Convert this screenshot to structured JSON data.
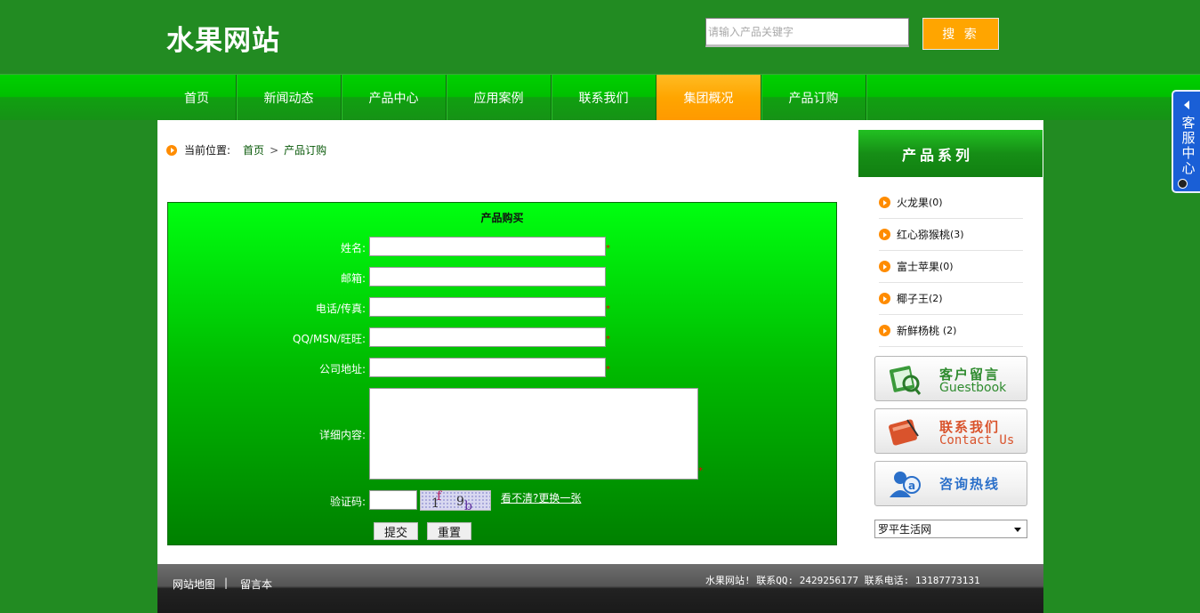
{
  "header": {
    "logo": "水果网站",
    "search_placeholder": "请输入产品关键字",
    "search_button": "搜 索"
  },
  "nav": {
    "items": [
      {
        "label": "首页"
      },
      {
        "label": "新闻动态"
      },
      {
        "label": "产品中心"
      },
      {
        "label": "应用案例"
      },
      {
        "label": "联系我们"
      },
      {
        "label": "集团概况",
        "active": true
      },
      {
        "label": "产品订购"
      }
    ]
  },
  "breadcrumb": {
    "label": "当前位置:",
    "home": "首页",
    "sep": ">",
    "current": "产品订购"
  },
  "form": {
    "title": "产品购买",
    "fields": {
      "name": "姓名:",
      "email": "邮箱:",
      "phone": "电话/传真:",
      "im": "QQ/MSN/旺旺:",
      "address": "公司地址:",
      "details": "详细内容:",
      "captcha": "验证码:"
    },
    "required_mark": "*",
    "captcha_chars": [
      "1",
      "f",
      "9",
      "b"
    ],
    "captcha_refresh": "看不清?更换一张",
    "submit": "提交",
    "reset": "重置"
  },
  "sidebar": {
    "title": "产品系列",
    "categories": [
      {
        "name": "火龙果",
        "count": "(0)"
      },
      {
        "name": "红心猕猴桃",
        "count": "(3)"
      },
      {
        "name": "富士苹果",
        "count": "(0)"
      },
      {
        "name": "椰子王",
        "count": "(2)"
      },
      {
        "name": "新鲜杨桃 ",
        "count": "(2)"
      }
    ],
    "cards": [
      {
        "title": "客户留言",
        "subtitle": "Guestbook",
        "icon": "guestbook-icon"
      },
      {
        "title": "联系我们",
        "subtitle": "Contact Us",
        "icon": "contact-book-icon"
      },
      {
        "title": "咨询热线",
        "subtitle": "",
        "icon": "hotline-user-icon"
      }
    ],
    "select_value": "罗平生活网"
  },
  "footer": {
    "sitemap": "网站地图",
    "sep": "|",
    "guestbook": "留言本",
    "info": "水果网站! 联系QQ: 2429256177 联系电话: 13187773131"
  },
  "service_tab": {
    "text": "客服中心"
  },
  "colors": {
    "background": "#228b22",
    "accent": "#ffa500",
    "card_green": "#2e8b2e",
    "card_red": "#d9532c",
    "card_blue": "#2a6fc9",
    "service_blue": "#1a5fd6"
  }
}
